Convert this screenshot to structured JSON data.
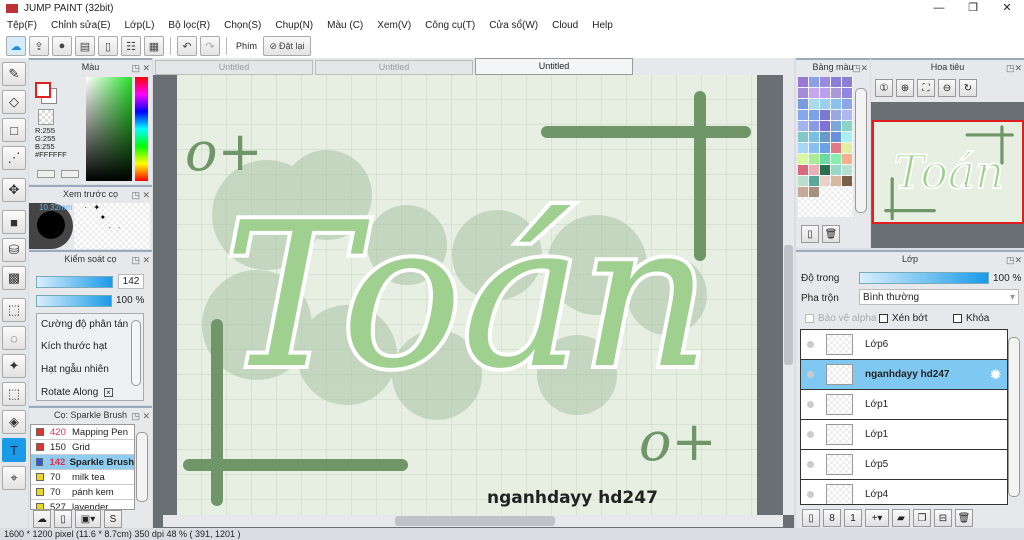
{
  "window": {
    "title": "JUMP PAINT (32bit)",
    "minimize": "—",
    "maximize": "❐",
    "close": "✕"
  },
  "menu": [
    "Tệp(F)",
    "Chỉnh sửa(E)",
    "Lớp(L)",
    "Bộ lọc(R)",
    "Chọn(S)",
    "Chụp(N)",
    "Màu (C)",
    "Xem(V)",
    "Công cụ(T)",
    "Cửa sổ(W)",
    "Cloud",
    "Help"
  ],
  "toolbar": {
    "keys_label": "Phím",
    "reset_label": "Đặt lại"
  },
  "color_panel": {
    "title": "Màu",
    "r": "R:255",
    "g": "G:255",
    "b": "B:255",
    "hex": "#FFFFFF"
  },
  "brush_preview": {
    "title": "Xem trước cọ",
    "size": "10.32mm"
  },
  "brush_control": {
    "title": "Kiểm soát cọ",
    "size_value": "142",
    "opacity_value": "100 %",
    "options": [
      "Cường độ phân tán",
      "Kích thước hạt",
      "Hạt ngẫu nhiên",
      "Rotate Along"
    ]
  },
  "brush_list": {
    "title": "Cọ: Sparkle Brush",
    "items": [
      {
        "size": "420",
        "name": "Mapping Pen",
        "color": "#e53030",
        "size_red": true
      },
      {
        "size": "150",
        "name": "Grid",
        "color": "#e53030",
        "size_red": false
      },
      {
        "size": "142",
        "name": "Sparkle Brush",
        "color": "#3355dd",
        "size_red": true,
        "selected": true
      },
      {
        "size": "70",
        "name": "milk tea",
        "color": "#e8d820",
        "size_red": false
      },
      {
        "size": "70",
        "name": "pánh kem",
        "color": "#e8d820",
        "size_red": false
      },
      {
        "size": "527",
        "name": "lavender",
        "color": "#e8d820",
        "size_red": false
      }
    ]
  },
  "tabs": [
    "Untitled",
    "Untitled",
    "Untitled"
  ],
  "artwork": {
    "title_text": "Toán",
    "signature": "nganhdayy hd247",
    "mark": "o+"
  },
  "status": "1600 * 1200 pixel   (11.6 * 8.7cm)   350 dpi   48 %   ( 391, 1201 )",
  "palette": {
    "title": "Bảng màu",
    "colors": [
      "#9a79d6",
      "#8aa0e6",
      "#9b8ae0",
      "#8a7fd6",
      "#8c7ed0",
      "#a58ad6",
      "#c6a6ec",
      "#b8a0ec",
      "#a89ad8",
      "#9088e0",
      "#7b9be0",
      "#a8dcea",
      "#98d0ee",
      "#8cc0ee",
      "#8aa8e8",
      "#86a8ec",
      "#7aa2e8",
      "#7c78d0",
      "#9aaae0",
      "#b0b8f0",
      "#a2b4ee",
      "#8a9aea",
      "#7e72d6",
      "#7aa8d8",
      "#88d4c8",
      "#82c8c8",
      "#78c0e0",
      "#6a98c8",
      "#6a8ee0",
      "#a8f0f0",
      "#a8d8f8",
      "#88c0f0",
      "#6ea0e8",
      "#e07a84",
      "#e0f0a0",
      "#d8f8a0",
      "#a8ec98",
      "#6adaa0",
      "#88eeb0",
      "#f4b08c",
      "#d8687a",
      "#eab0b8",
      "#2a7050",
      "#98d8c8",
      "#b8e0d0",
      "#b8e0d0",
      "#58a898",
      "#ecd0c8",
      "#d8b8a0",
      "#7a6048",
      "#c8a898",
      "#a89080"
    ]
  },
  "navigator": {
    "title": "Hoa tiêu"
  },
  "layers": {
    "title": "Lớp",
    "opacity_label": "Độ trong",
    "opacity_value": "100 %",
    "opacity": 1.0,
    "blend_label": "Pha trộn",
    "blend_value": "Bình thường",
    "protect_alpha": "Bảo vệ alpha",
    "clip": "Xén bớt",
    "lock": "Khóa",
    "items": [
      {
        "name": "Lớp6"
      },
      {
        "name": "nganhdayy hd247",
        "selected": true
      },
      {
        "name": "Lớp1"
      },
      {
        "name": "Lớp1"
      },
      {
        "name": "Lớp5"
      },
      {
        "name": "Lớp4"
      }
    ]
  }
}
